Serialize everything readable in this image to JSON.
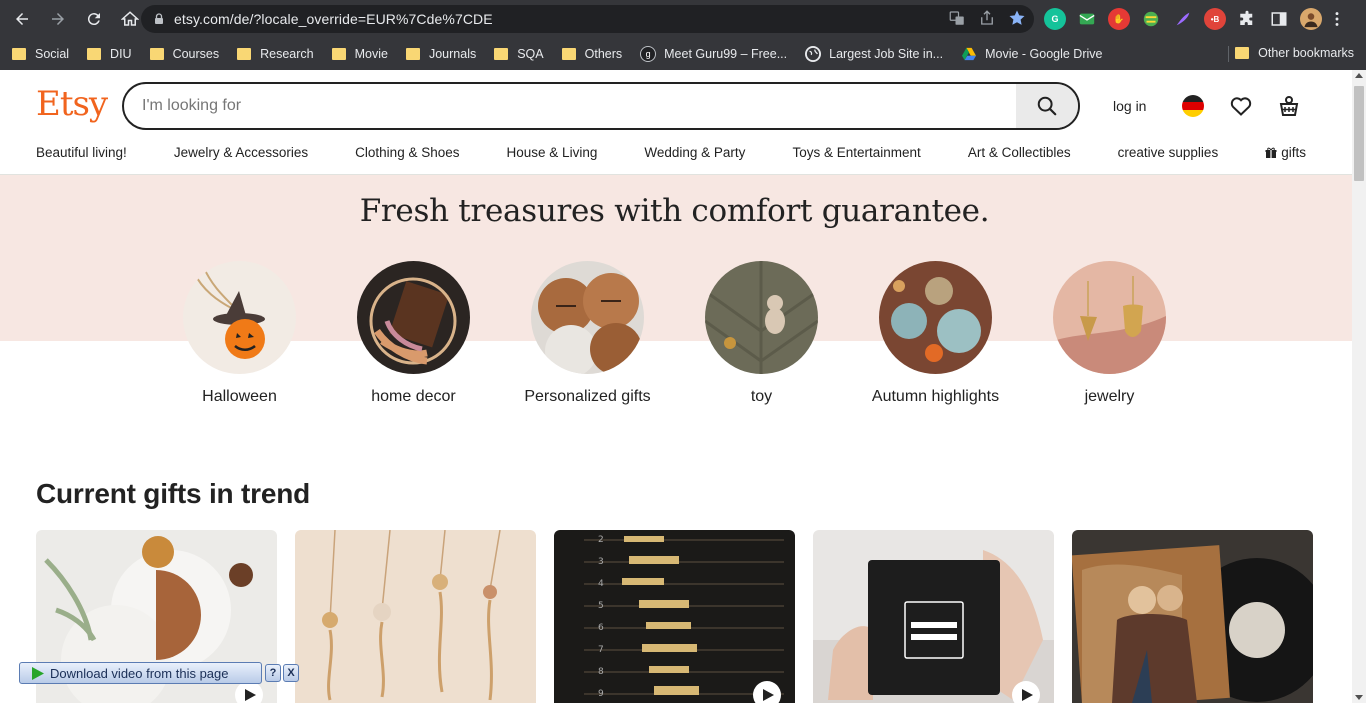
{
  "browser": {
    "url": "etsy.com/de/?locale_override=EUR%7Cde%7CDE",
    "bookmarks": [
      {
        "label": "Social",
        "type": "folder"
      },
      {
        "label": "DIU",
        "type": "folder"
      },
      {
        "label": "Courses",
        "type": "folder"
      },
      {
        "label": "Research",
        "type": "folder"
      },
      {
        "label": "Movie",
        "type": "folder"
      },
      {
        "label": "Journals",
        "type": "folder"
      },
      {
        "label": "SQA",
        "type": "folder"
      },
      {
        "label": "Others",
        "type": "folder"
      },
      {
        "label": "Meet Guru99 – Free...",
        "type": "link"
      },
      {
        "label": "Largest Job Site in...",
        "type": "link"
      },
      {
        "label": "Movie - Google Drive",
        "type": "link"
      }
    ],
    "other_bookmarks": "Other bookmarks"
  },
  "header": {
    "logo": "Etsy",
    "search_placeholder": "I'm looking for",
    "login": "log in"
  },
  "categories": [
    "Beautiful living!",
    "Jewelry & Accessories",
    "Clothing & Shoes",
    "House & Living",
    "Wedding & Party",
    "Toys & Entertainment",
    "Art & Collectibles",
    "creative supplies"
  ],
  "gifts_label": "gifts",
  "hero": {
    "title": "Fresh treasures with comfort guarantee.",
    "circles": [
      {
        "label": "Halloween"
      },
      {
        "label": "home decor"
      },
      {
        "label": "Personalized gifts"
      },
      {
        "label": "toy"
      },
      {
        "label": "Autumn highlights"
      },
      {
        "label": "jewelry"
      }
    ]
  },
  "trend": {
    "title": "Current gifts in trend"
  },
  "download_bar": {
    "label": "Download video from this page",
    "help": "?",
    "close": "X"
  },
  "colors": {
    "brand": "#f1641e",
    "hero_bg": "#f7e7e2",
    "chrome": "#35363a"
  }
}
